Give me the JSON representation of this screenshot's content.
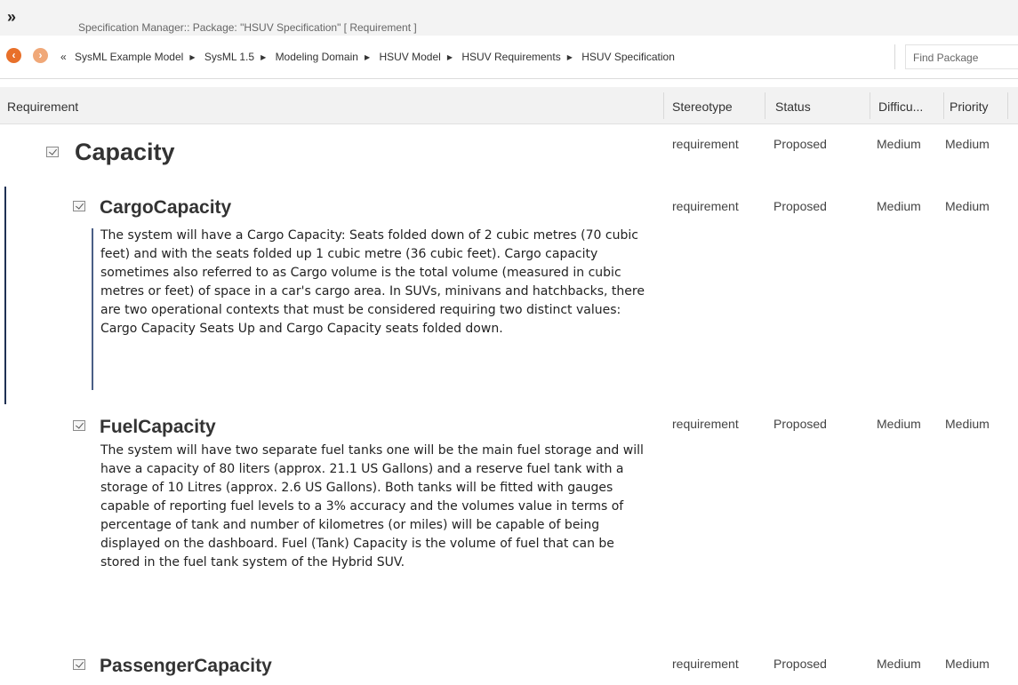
{
  "window": {
    "title": "Specification Manager::  Package: \"HSUV Specification\"  [ Requirement ]"
  },
  "nav": {
    "lead": "«",
    "breadcrumbs": [
      "SysML Example Model",
      "SysML 1.5",
      "Modeling Domain",
      "HSUV Model",
      "HSUV Requirements",
      "HSUV Specification"
    ],
    "find_label": "Find Package"
  },
  "columns": {
    "requirement": "Requirement",
    "stereotype": "Stereotype",
    "status": "Status",
    "difficulty": "Difficu...",
    "priority": "Priority"
  },
  "items": [
    {
      "name": "Capacity",
      "stereotype": "requirement",
      "status": "Proposed",
      "difficulty": "Medium",
      "priority": "Medium",
      "description": ""
    },
    {
      "name": "CargoCapacity",
      "stereotype": "requirement",
      "status": "Proposed",
      "difficulty": "Medium",
      "priority": "Medium",
      "description": "The system will have a Cargo Capacity: Seats folded down of 2 cubic metres (70 cubic feet) and with the seats folded up 1 cubic metre (36 cubic feet). Cargo capacity sometimes also referred to as Cargo volume is the total volume (measured in cubic metres or feet) of space in a car's cargo area. In SUVs, minivans and hatchbacks, there are two operational contexts that must be considered requiring two distinct values: Cargo Capacity Seats Up and Cargo Capacity seats folded down."
    },
    {
      "name": "FuelCapacity",
      "stereotype": "requirement",
      "status": "Proposed",
      "difficulty": "Medium",
      "priority": "Medium",
      "description": "The system will have two separate fuel tanks one will be the main fuel storage and will have a capacity of 80 liters (approx. 21.1 US Gallons) and a reserve fuel tank with a storage of 10 Litres (approx. 2.6 US Gallons). Both tanks will be fitted with gauges capable of reporting fuel levels to a 3% accuracy and the volumes value in terms of percentage of tank and number of kilometres (or miles) will be capable of being displayed on the dashboard. Fuel (Tank) Capacity is the volume of fuel that can be stored in the fuel tank system of the Hybrid SUV."
    },
    {
      "name": "PassengerCapacity",
      "stereotype": "requirement",
      "status": "Proposed",
      "difficulty": "Medium",
      "priority": "Medium",
      "description": ""
    }
  ]
}
